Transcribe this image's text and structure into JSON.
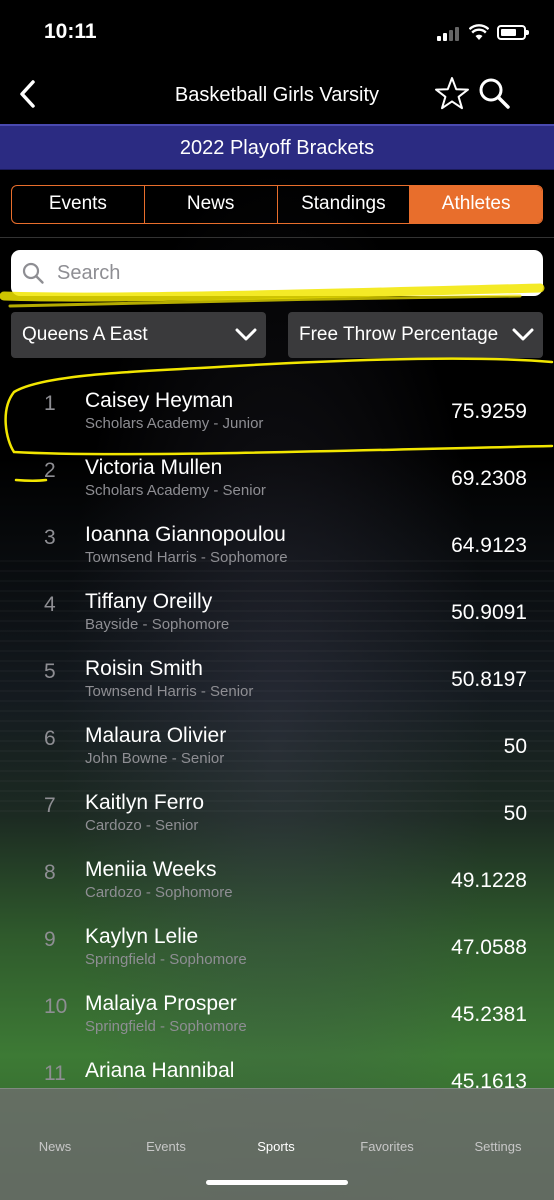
{
  "status": {
    "time": "10:11"
  },
  "nav": {
    "title": "Basketball Girls Varsity"
  },
  "banner": {
    "label": "2022 Playoff Brackets"
  },
  "tabs": [
    {
      "label": "Events"
    },
    {
      "label": "News"
    },
    {
      "label": "Standings"
    },
    {
      "label": "Athletes"
    }
  ],
  "search": {
    "placeholder": "Search"
  },
  "filters": {
    "league": "Queens A East",
    "stat": "Free Throw Percentage"
  },
  "athletes": [
    {
      "rank": "1",
      "name": "Caisey Heyman",
      "school": "Scholars Academy - Junior",
      "value": "75.9259"
    },
    {
      "rank": "2",
      "name": "Victoria Mullen",
      "school": "Scholars Academy - Senior",
      "value": "69.2308"
    },
    {
      "rank": "3",
      "name": "Ioanna Giannopoulou",
      "school": "Townsend Harris - Sophomore",
      "value": "64.9123"
    },
    {
      "rank": "4",
      "name": "Tiffany Oreilly",
      "school": "Bayside - Sophomore",
      "value": "50.9091"
    },
    {
      "rank": "5",
      "name": "Roisin Smith",
      "school": "Townsend Harris - Senior",
      "value": "50.8197"
    },
    {
      "rank": "6",
      "name": "Malaura Olivier",
      "school": "John Bowne - Senior",
      "value": "50"
    },
    {
      "rank": "7",
      "name": "Kaitlyn Ferro",
      "school": "Cardozo - Senior",
      "value": "50"
    },
    {
      "rank": "8",
      "name": "Meniia Weeks",
      "school": "Cardozo - Sophomore",
      "value": "49.1228"
    },
    {
      "rank": "9",
      "name": "Kaylyn Lelie",
      "school": "Springfield - Sophomore",
      "value": "47.0588"
    },
    {
      "rank": "10",
      "name": "Malaiya Prosper",
      "school": "Springfield - Sophomore",
      "value": "45.2381"
    },
    {
      "rank": "11",
      "name": "Ariana Hannibal",
      "school": "",
      "value": "45.1613"
    }
  ],
  "tabbar": {
    "items": [
      {
        "label": "News"
      },
      {
        "label": "Events"
      },
      {
        "label": "Sports"
      },
      {
        "label": "Favorites"
      },
      {
        "label": "Settings"
      }
    ]
  },
  "colors": {
    "accent": "#e86e2c",
    "banner": "#2b2b82",
    "highlighter": "#f2e600"
  }
}
